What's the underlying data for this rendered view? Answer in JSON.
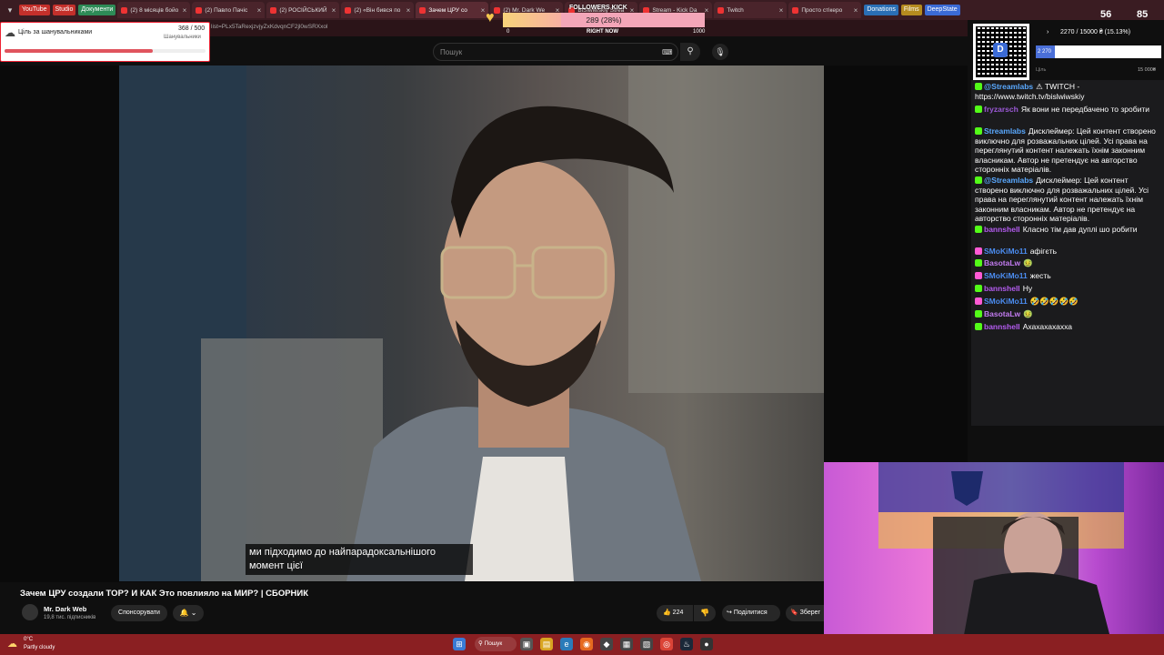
{
  "browser": {
    "bookmarks": [
      "YouTube",
      "Studio",
      "Документи",
      "Donations",
      "Films",
      "DeepState"
    ],
    "tabs": [
      {
        "title": "(2) 8 місяців бойо",
        "active": false
      },
      {
        "title": "(2) Павло Пачіс",
        "active": false
      },
      {
        "title": "(2) РОСІЙСЬКИЙ",
        "active": false
      },
      {
        "title": "(2) «Він бився по",
        "active": false
      },
      {
        "title": "Зачем ЦРУ со",
        "active": true
      },
      {
        "title": "(2) Mr. Dark We",
        "active": false
      },
      {
        "title": "BiSlwiwskiy Strea",
        "active": false
      },
      {
        "title": "Stream - Kick Da",
        "active": false
      },
      {
        "title": "Twitch",
        "active": false
      },
      {
        "title": "Просто стікеро",
        "active": false
      }
    ],
    "url": "list=PLx5TaRexjzvjyZxKdvqnCF2jl0wSRXxol"
  },
  "youtube": {
    "search_placeholder": "Пошук",
    "caption_text": "ми підходимо до найпарадоксальнішого момент цієї",
    "video_title": "Зачем ЦРУ создали TOP? И КАК Это повлияло на МИР? | СБОРНИК",
    "channel_name": "Mr. Dark Web",
    "channel_subs": "19,8 тис. підписників",
    "sponsor_label": "Спонсорувати",
    "like_count": "224",
    "share_label": "Поділитися",
    "save_label": "Зберег"
  },
  "goal": {
    "label": "Ціль за шанувальниками",
    "current": "368",
    "target": "500",
    "count_text": "368 / 500",
    "sub_label": "Шанувальники",
    "progress": 0.736,
    "color": "#e0545e"
  },
  "followers": {
    "label": "FOLLOWERS KICK",
    "value_text": "289 (28%)",
    "progress": 0.289,
    "min": "0",
    "now": "RIGHT NOW",
    "max": "1000"
  },
  "donations": {
    "header": "2270 / 15000 ₴ (15.13%)",
    "fill_text": "2 270",
    "progress": 0.1513,
    "min_label": "Ціль",
    "max_label": "15 000₴"
  },
  "stats": {
    "a": "56",
    "b": "85"
  },
  "chat": [
    {
      "user": "@Streamlabs",
      "text": "⚠ TWITCH - https://www.twitch.tv/bislwiwskiy",
      "color": "#5aa9ff",
      "badge": "#53fc18"
    },
    {
      "user": "fryzarsch",
      "text": "Як вони не передбачено то зробити",
      "color": "#9b59d6",
      "badge": "#53fc18"
    },
    {
      "user": "Streamlabs",
      "text": "Дисклеймер: Цей контент створено виключно для розважальних цілей. Усі права на переглянутий контент належать їхнім законним власникам. Автор не претендує на авторство сторонніх матеріалів.",
      "color": "#5aa9ff",
      "badge": "#53fc18"
    },
    {
      "user": "@Streamlabs",
      "text": "Дисклеймер: Цей контент створено виключно для розважальних цілей. Усі права на переглянутий контент належать їхнім законним власникам. Автор не претендує на авторство сторонніх матеріалів.",
      "color": "#5aa9ff",
      "badge": "#53fc18"
    },
    {
      "user": "bannshell",
      "text": "Класно тім дав дуплі шо робити",
      "color": "#b45cf0",
      "badge": "#53fc18"
    },
    {
      "user": "SMoKiMo11",
      "text": "афігєть",
      "color": "#4b8cf0",
      "badge": "#ff5ad5"
    },
    {
      "user": "BasotaLw",
      "text": "🤢",
      "color": "#c27bf0",
      "badge": "#53fc18"
    },
    {
      "user": "SMoKiMo11",
      "text": "жесть",
      "color": "#4b8cf0",
      "badge": "#ff5ad5"
    },
    {
      "user": "bannshell",
      "text": "Ну",
      "color": "#b45cf0",
      "badge": "#53fc18"
    },
    {
      "user": "SMoKiMo11",
      "text": "🤣🤣🤣🤣🤣",
      "color": "#4b8cf0",
      "badge": "#ff5ad5"
    },
    {
      "user": "BasotaLw",
      "text": "🤢",
      "color": "#c27bf0",
      "badge": "#53fc18"
    },
    {
      "user": "bannshell",
      "text": "Ахахахахахха",
      "color": "#b45cf0",
      "badge": "#53fc18"
    }
  ],
  "taskbar": {
    "weather_temp": "0°C",
    "weather_desc": "Partly cloudy",
    "search_label": "Пошук"
  },
  "colors": {
    "taskbar": "#8a1f22",
    "tabbar": "#3a1c22",
    "accent": "#e0545e"
  }
}
